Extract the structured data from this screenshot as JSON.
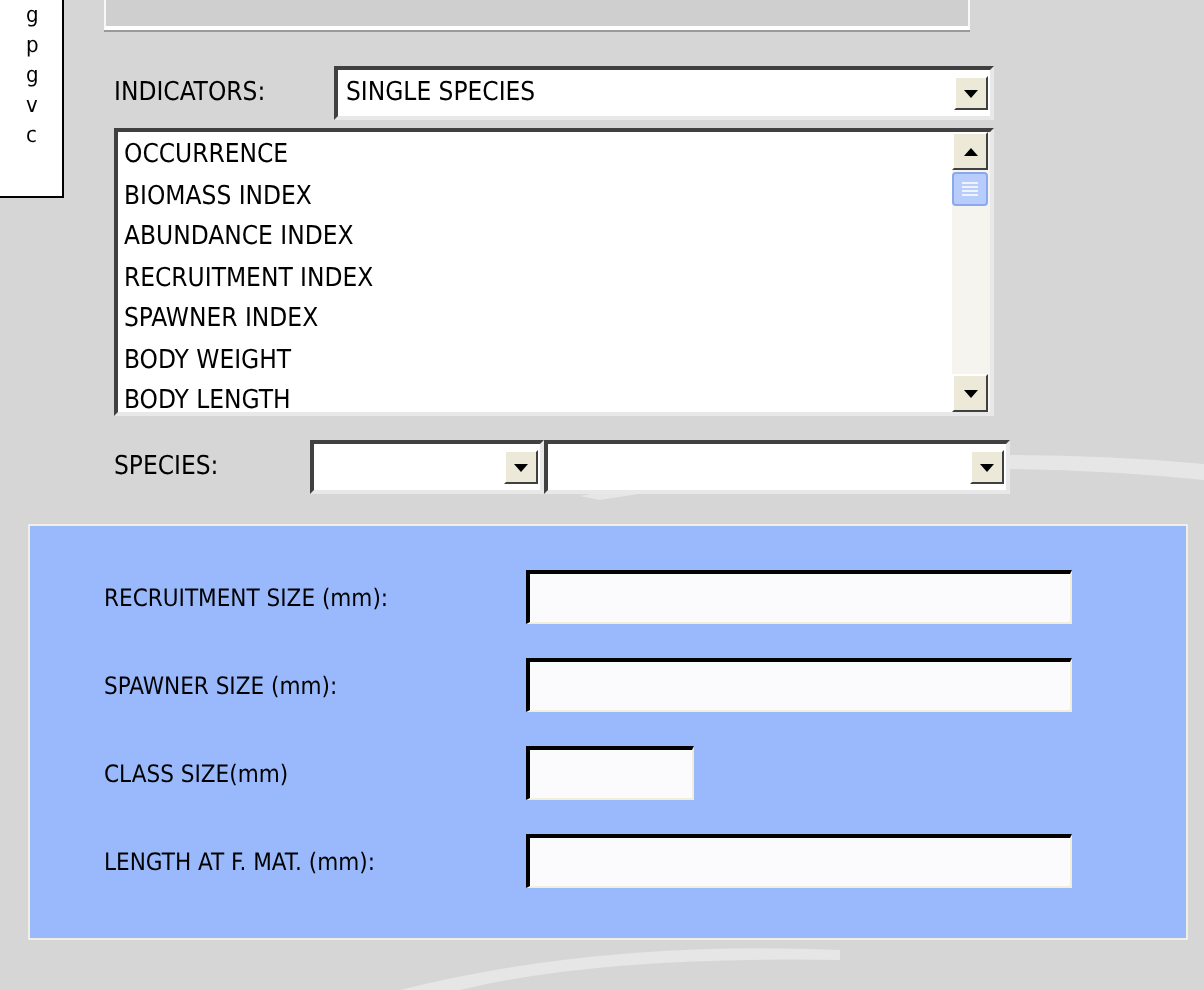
{
  "side_list": {
    "items": [
      "g",
      "p",
      "g",
      "v",
      "c"
    ]
  },
  "indicators": {
    "label": "INDICATORS:",
    "value": "SINGLE SPECIES"
  },
  "indicator_list": {
    "items": [
      "OCCURRENCE",
      "BIOMASS INDEX",
      "ABUNDANCE INDEX",
      "RECRUITMENT INDEX",
      "SPAWNER INDEX",
      "BODY WEIGHT",
      "BODY LENGTH"
    ]
  },
  "species": {
    "label": "SPECIES:"
  },
  "size_fields": [
    {
      "label": "RECRUITMENT SIZE (mm):",
      "kind": "wide"
    },
    {
      "label": "SPAWNER SIZE (mm):",
      "kind": "wide"
    },
    {
      "label": "CLASS SIZE(mm)",
      "kind": "narrow"
    },
    {
      "label": "LENGTH AT F. MAT. (mm):",
      "kind": "wide"
    }
  ]
}
